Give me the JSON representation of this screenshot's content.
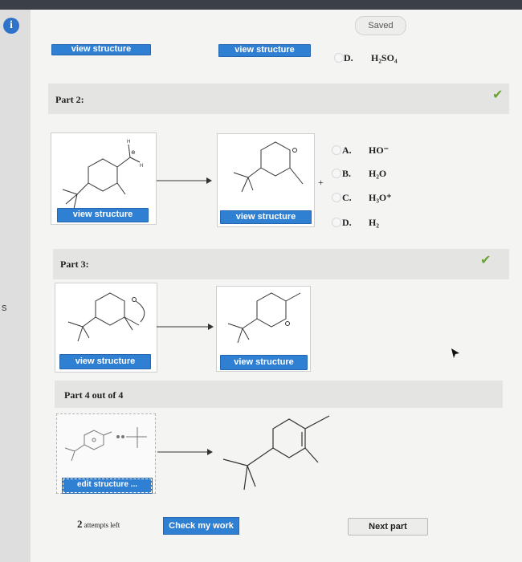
{
  "status": {
    "saved_label": "Saved"
  },
  "gutter": {
    "letter": "s",
    "info_glyph": "i"
  },
  "top_partial": {
    "button_left": "view structure",
    "button_right": "view structure",
    "option": {
      "letter": "D.",
      "formula": "H₂SO₄"
    }
  },
  "part2": {
    "label": "Part 2:",
    "status": "correct",
    "button_left": "view structure",
    "button_right": "view structure",
    "plus": "+",
    "options": [
      {
        "letter": "A.",
        "formula": "HO⁻"
      },
      {
        "letter": "B.",
        "formula": "H₂O"
      },
      {
        "letter": "C.",
        "formula": "H₃O⁺"
      },
      {
        "letter": "D.",
        "formula": "H₂"
      }
    ],
    "atom_labels": {
      "h_top": "H",
      "h_right": "H",
      "charge": "⊕"
    }
  },
  "part3": {
    "label": "Part 3:",
    "status": "correct",
    "button_left": "view structure",
    "button_right": "view structure"
  },
  "part4": {
    "label": "Part 4 out of 4",
    "edit_button": "edit structure ..."
  },
  "footer": {
    "attempts_count": "2",
    "attempts_label": "attempts left",
    "check_button": "Check my work",
    "next_button": "Next part"
  },
  "colors": {
    "accent": "#2f7fd3",
    "check": "#6aa533",
    "band": "#e4e4e2"
  },
  "icons": [
    "info-icon",
    "checkmark-icon",
    "arrow-icon",
    "cursor-icon"
  ]
}
